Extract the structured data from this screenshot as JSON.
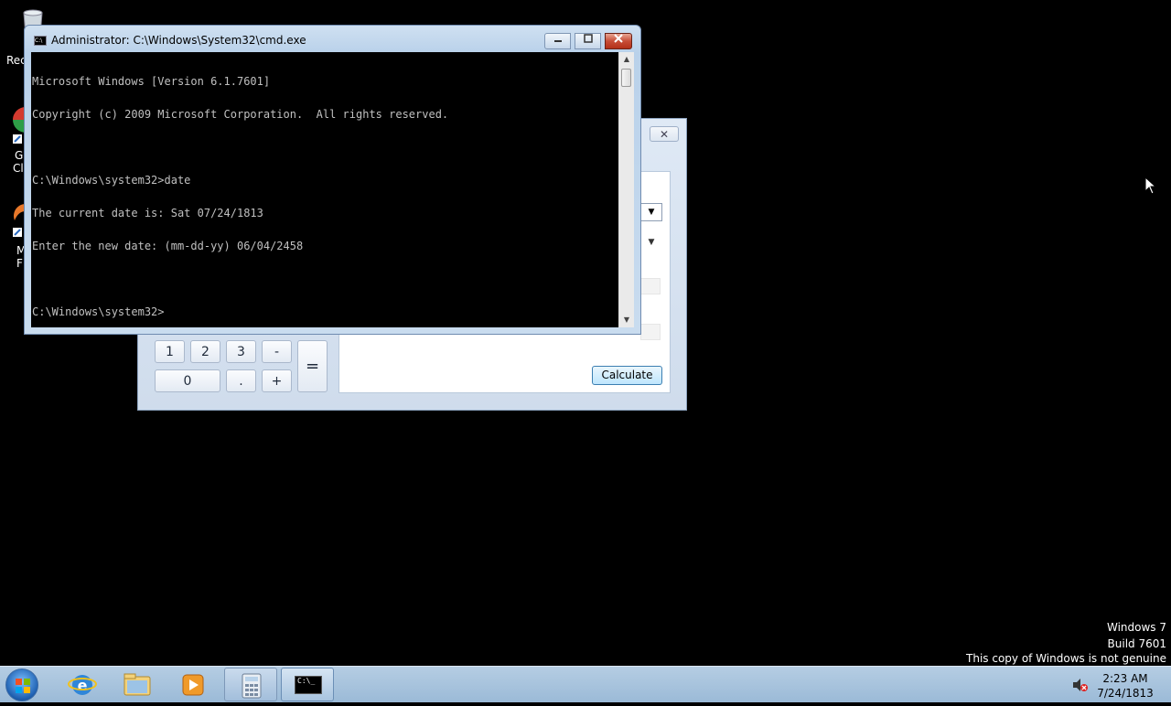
{
  "desktop": {
    "icon_labels": [
      "Rec",
      "G",
      "Cl",
      "M",
      "F"
    ]
  },
  "calculator": {
    "close_label": "✕",
    "keys": [
      "1",
      "2",
      "3",
      "-",
      "=",
      "0",
      ".",
      "+"
    ],
    "calculate_button": "Calculate"
  },
  "cmd_window": {
    "title": "Administrator: C:\\Windows\\System32\\cmd.exe",
    "icon_text": "C:\\",
    "lines": [
      "Microsoft Windows [Version 6.1.7601]",
      "Copyright (c) 2009 Microsoft Corporation.  All rights reserved.",
      "",
      "C:\\Windows\\system32>date",
      "The current date is: Sat 07/24/1813",
      "Enter the new date: (mm-dd-yy) 06/04/2458",
      "",
      "C:\\Windows\\system32>"
    ]
  },
  "watermark": {
    "line1": "Windows 7",
    "line2": "Build 7601",
    "line3": "This copy of Windows is not genuine"
  },
  "taskbar": {
    "items": [
      "start-button",
      "internet-explorer",
      "windows-explorer",
      "media-player",
      "calculator",
      "command-prompt"
    ],
    "cmd_icon_text": "C:\\_",
    "time": "2:23 AM",
    "date": "7/24/1813"
  }
}
